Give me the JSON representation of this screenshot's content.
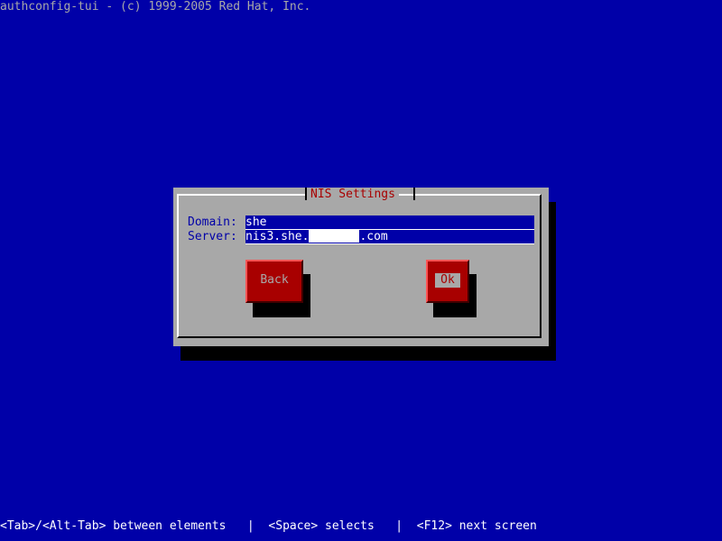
{
  "top_title": "authconfig-tui - (c) 1999-2005 Red Hat, Inc.",
  "dialog": {
    "title": "NIS Settings",
    "fields": {
      "domain": {
        "label": "Domain:",
        "value": "she"
      },
      "server": {
        "label": "Server:",
        "value_prefix": "nis3.she.",
        "value_suffix": ".com"
      }
    },
    "buttons": {
      "back": "Back",
      "ok": "Ok"
    }
  },
  "help_bar": "<Tab>/<Alt-Tab> between elements   |  <Space> selects   |  <F12> next screen",
  "colors": {
    "background": "#0000a8",
    "dialog": "#a8a8a8",
    "title_text": "#a80000",
    "button": "#a80000",
    "input_background": "#0000a8",
    "input_text": "#ffffff"
  }
}
